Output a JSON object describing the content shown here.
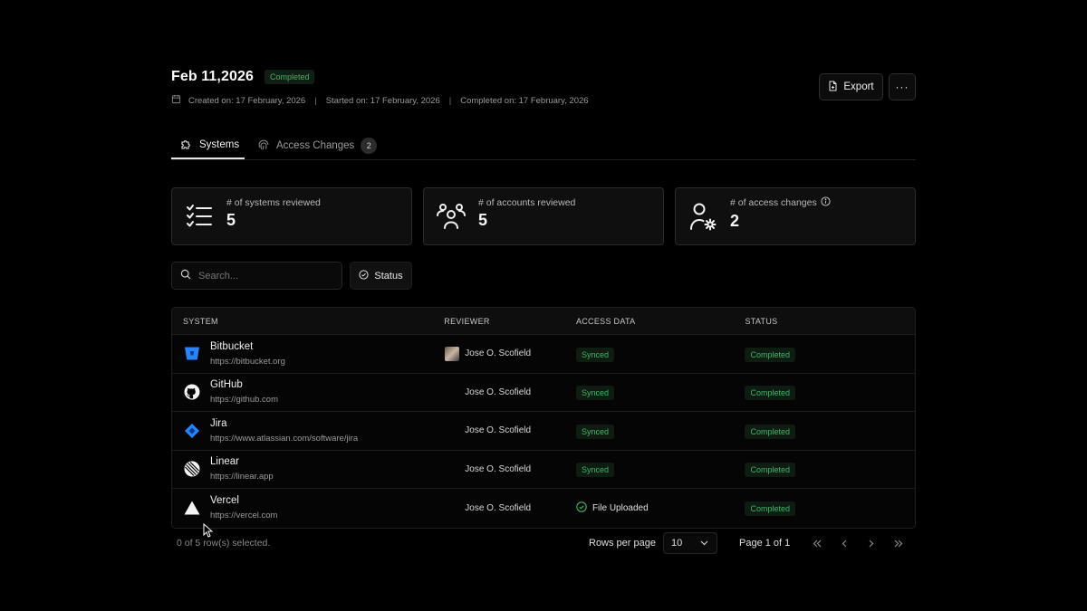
{
  "header": {
    "title": "Feb 11,2026",
    "status_badge": "Completed",
    "created": "Created on: 17 February, 2026",
    "started": "Started on: 17 February, 2026",
    "completed": "Completed on: 17 February, 2026",
    "separator": "|",
    "export_label": "Export",
    "more_label": "···"
  },
  "tabs": [
    {
      "label": "Systems",
      "icon": "puzzle-icon",
      "active": true
    },
    {
      "label": "Access Changes",
      "icon": "fingerprint-icon",
      "count": "2"
    }
  ],
  "stats": [
    {
      "label": "# of systems reviewed",
      "value": "5",
      "icon": "checklist-icon"
    },
    {
      "label": "# of accounts reviewed",
      "value": "5",
      "icon": "users-icon"
    },
    {
      "label": "# of access changes",
      "value": "2",
      "icon": "user-gear-icon"
    }
  ],
  "filters": {
    "search_placeholder": "Search...",
    "status_label": "Status"
  },
  "table": {
    "columns": [
      "SYSTEM",
      "REVIEWER",
      "ACCESS DATA",
      "STATUS"
    ],
    "rows": [
      {
        "name": "Bitbucket",
        "url": "https://bitbucket.org",
        "reviewer": "Jose O. Scofield",
        "access": "Synced",
        "status": "Completed",
        "logo": "bitbucket-logo-icon"
      },
      {
        "name": "GitHub",
        "url": "https://github.com",
        "reviewer": "Jose O. Scofield",
        "access": "Synced",
        "status": "Completed",
        "logo": "github-logo-icon"
      },
      {
        "name": "Jira",
        "url": "https://www.atlassian.com/software/jira",
        "reviewer": "Jose O. Scofield",
        "access": "Synced",
        "status": "Completed",
        "logo": "jira-logo-icon"
      },
      {
        "name": "Linear",
        "url": "https://linear.app",
        "reviewer": "Jose O. Scofield",
        "access": "Synced",
        "status": "Completed",
        "logo": "linear-logo-icon"
      },
      {
        "name": "Vercel",
        "url": "https://vercel.com",
        "reviewer": "Jose O. Scofield",
        "access": "File Uploaded",
        "status": "Completed",
        "logo": "vercel-logo-icon"
      }
    ]
  },
  "footer": {
    "selection": "0 of 5 row(s) selected.",
    "rows_per_page_label": "Rows per page",
    "rows_per_page_value": "10",
    "page_info": "Page 1 of 1"
  },
  "colors": {
    "background": "#000000",
    "success": "#3fb56a",
    "bitbucket": "#2684ff",
    "jira": "#2684ff"
  }
}
